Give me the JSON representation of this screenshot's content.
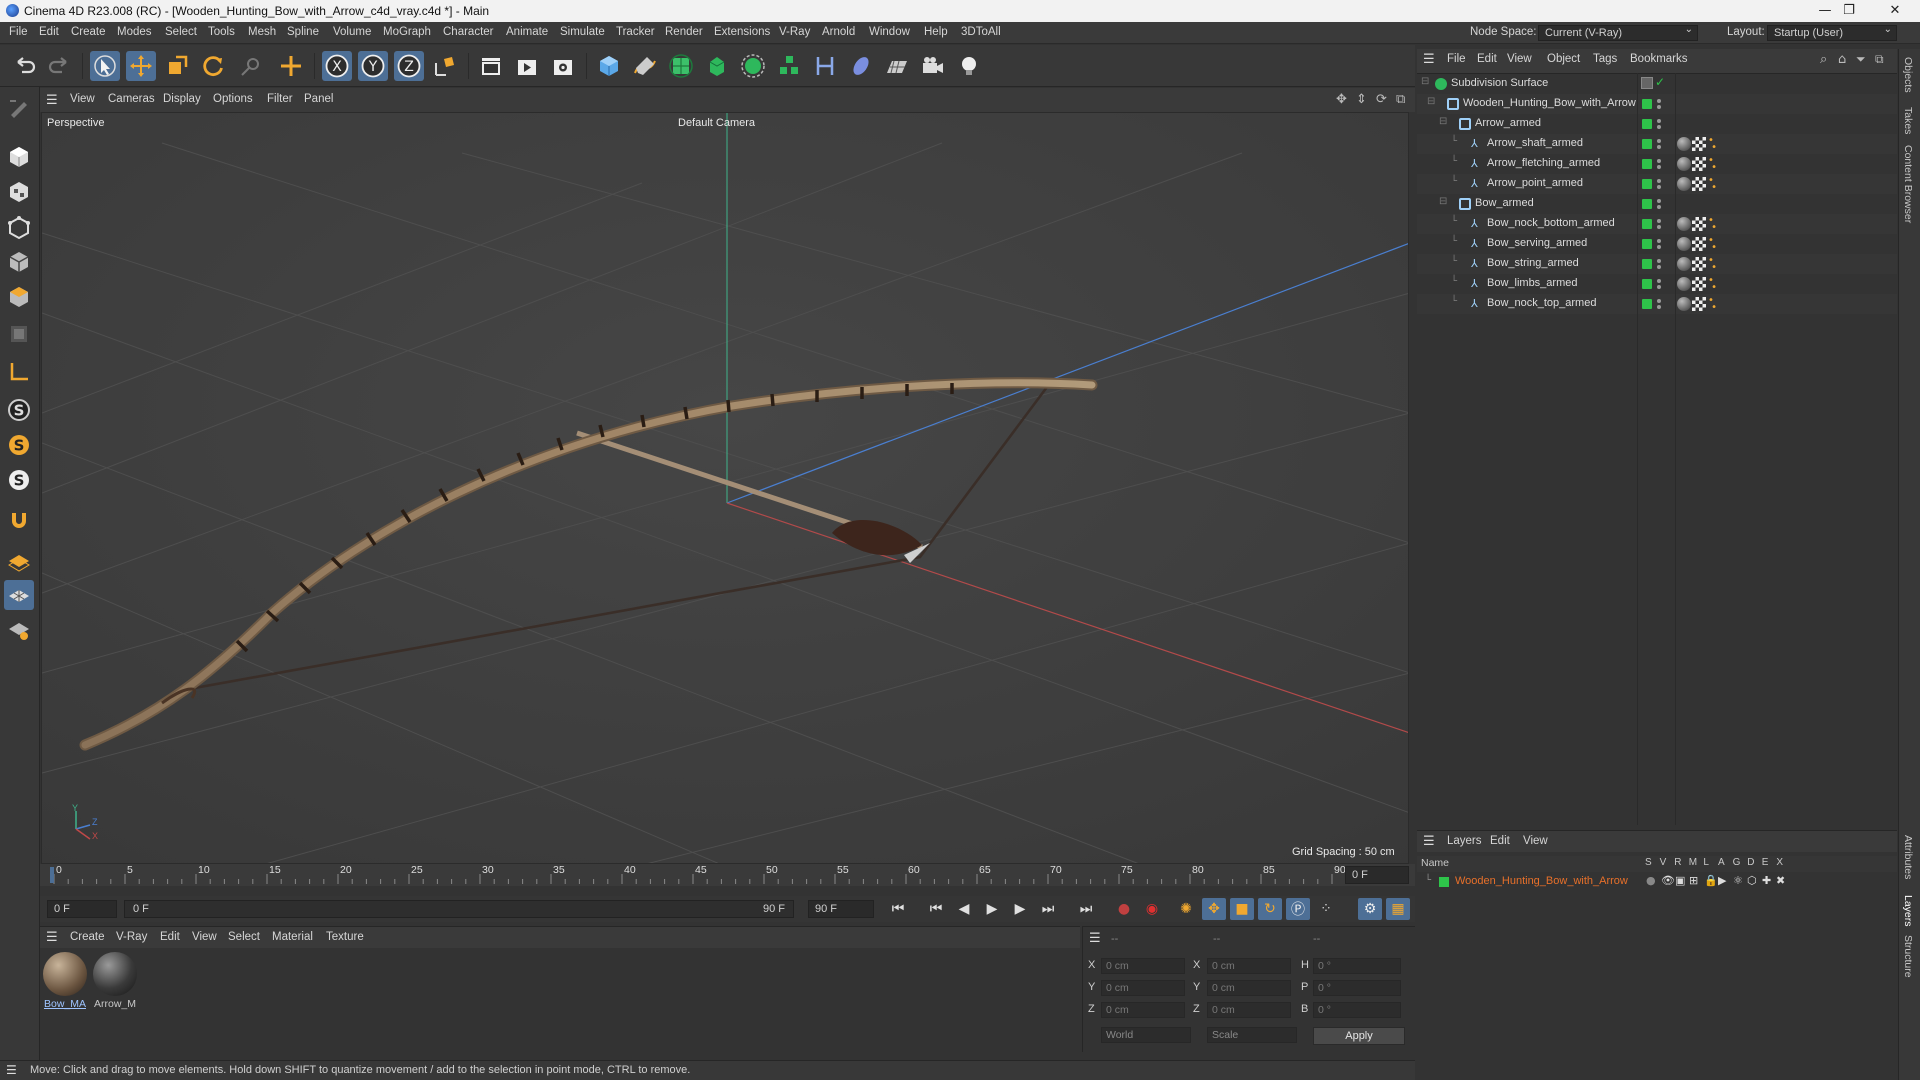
{
  "window": {
    "title": "Cinema 4D R23.008 (RC) - [Wooden_Hunting_Bow_with_Arrow_c4d_vray.c4d *] - Main",
    "controls": [
      "—",
      "❐",
      "✕"
    ]
  },
  "menubar": {
    "items": [
      "File",
      "Edit",
      "Create",
      "Modes",
      "Select",
      "Tools",
      "Mesh",
      "Spline",
      "Volume",
      "MoGraph",
      "Character",
      "Animate",
      "Simulate",
      "Tracker",
      "Render",
      "Extensions",
      "V-Ray",
      "Arnold",
      "Window",
      "Help",
      "3DToAll"
    ],
    "node_space_label": "Node Space:",
    "node_space_value": "Current (V-Ray)",
    "layout_label": "Layout:",
    "layout_value": "Startup (User)"
  },
  "viewport": {
    "menu": [
      "View",
      "Cameras",
      "Display",
      "Options",
      "Filter",
      "Panel"
    ],
    "view_name": "Perspective",
    "camera": "Default Camera",
    "grid_spacing": "Grid Spacing : 50 cm",
    "axis_labels": {
      "y": "Y",
      "z": "Z",
      "x": "X"
    }
  },
  "timeline": {
    "ticks": [
      "0",
      "5",
      "10",
      "15",
      "20",
      "25",
      "30",
      "35",
      "40",
      "45",
      "50",
      "55",
      "60",
      "65",
      "70",
      "75",
      "80",
      "85",
      "90"
    ],
    "current_frame": "0 F",
    "start_field": "0 F",
    "range_start": "0 F",
    "range_end": "90 F",
    "end_field": "90 F"
  },
  "materials": {
    "menu": [
      "Create",
      "V-Ray",
      "Edit",
      "View",
      "Select",
      "Material",
      "Texture"
    ],
    "items": [
      {
        "label": "Bow_MA"
      },
      {
        "label": "Arrow_M"
      }
    ]
  },
  "coordinates": {
    "headers": [
      "--",
      "--",
      "--"
    ],
    "rows": [
      {
        "a": "X",
        "av": "0 cm",
        "b": "X",
        "bv": "0 cm",
        "c": "H",
        "cv": "0 °"
      },
      {
        "a": "Y",
        "av": "0 cm",
        "b": "Y",
        "bv": "0 cm",
        "c": "P",
        "cv": "0 °"
      },
      {
        "a": "Z",
        "av": "0 cm",
        "b": "Z",
        "bv": "0 cm",
        "c": "B",
        "cv": "0 °"
      }
    ],
    "space": "World",
    "mode": "Scale",
    "apply": "Apply"
  },
  "status": "Move: Click and drag to move elements. Hold down SHIFT to quantize movement / add to the selection in point mode, CTRL to remove.",
  "objects": {
    "menu": [
      "File",
      "Edit",
      "View",
      "Object",
      "Tags",
      "Bookmarks"
    ],
    "tree": [
      {
        "name": "Subdivision Surface",
        "level": 0,
        "kind": "subdiv"
      },
      {
        "name": "Wooden_Hunting_Bow_with_Arrow",
        "level": 1,
        "kind": "null"
      },
      {
        "name": "Arrow_armed",
        "level": 2,
        "kind": "null"
      },
      {
        "name": "Arrow_shaft_armed",
        "level": 3,
        "kind": "bone"
      },
      {
        "name": "Arrow_fletching_armed",
        "level": 3,
        "kind": "bone"
      },
      {
        "name": "Arrow_point_armed",
        "level": 3,
        "kind": "bone"
      },
      {
        "name": "Bow_armed",
        "level": 2,
        "kind": "null"
      },
      {
        "name": "Bow_nock_bottom_armed",
        "level": 3,
        "kind": "bone"
      },
      {
        "name": "Bow_serving_armed",
        "level": 3,
        "kind": "bone"
      },
      {
        "name": "Bow_string_armed",
        "level": 3,
        "kind": "bone"
      },
      {
        "name": "Bow_limbs_armed",
        "level": 3,
        "kind": "bone"
      },
      {
        "name": "Bow_nock_top_armed",
        "level": 3,
        "kind": "bone"
      }
    ]
  },
  "layers": {
    "menu": [
      "Layers",
      "Edit",
      "View"
    ],
    "col_name": "Name",
    "cols": [
      "S",
      "V",
      "R",
      "M",
      "L",
      "A",
      "G",
      "D",
      "E",
      "X"
    ],
    "items": [
      {
        "name": "Wooden_Hunting_Bow_with_Arrow",
        "color": "#e8702a"
      }
    ]
  },
  "side_tabs": {
    "top": [
      "Objects",
      "Takes",
      "Content Browser"
    ],
    "bottom": [
      "Attributes",
      "Layers",
      "Structure"
    ]
  },
  "colors": {
    "accent": "#4d6f96",
    "green": "#2ec44a",
    "layer_name": "#e8702a"
  }
}
